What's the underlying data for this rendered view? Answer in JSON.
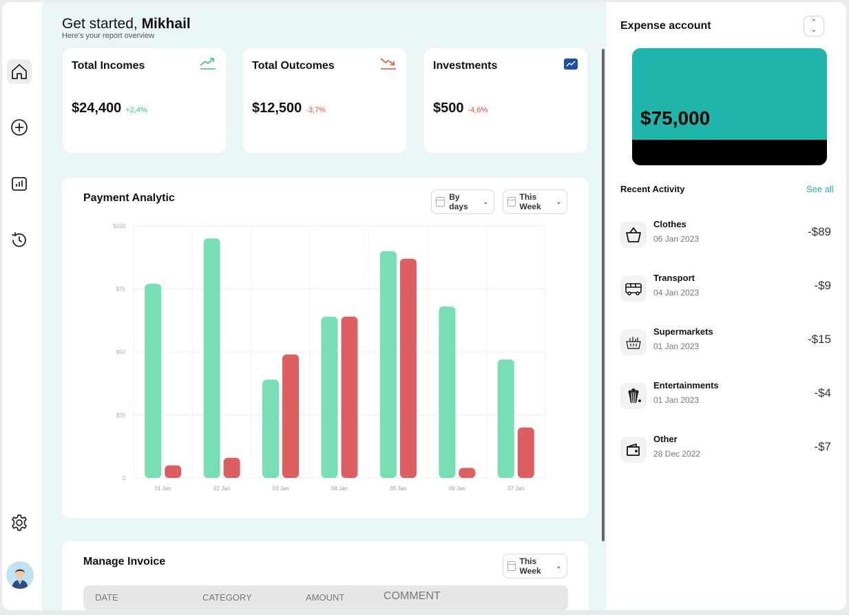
{
  "greeting": {
    "prefix": "Get started,",
    "name": "Mikhail",
    "subtitle": "Here's your report overview"
  },
  "sidebar": {
    "items": [
      {
        "name": "home",
        "icon": "home-icon"
      },
      {
        "name": "add",
        "icon": "plus-circle-icon"
      },
      {
        "name": "reports",
        "icon": "bar-chart-icon"
      },
      {
        "name": "history",
        "icon": "history-icon"
      },
      {
        "name": "settings",
        "icon": "gear-icon"
      }
    ]
  },
  "cards": [
    {
      "label": "Total Incomes",
      "amount": "$24,400",
      "change": "+2,4%",
      "color": "#2ecc71",
      "icon": "trending-up-icon"
    },
    {
      "label": "Total Outcomes",
      "amount": "$12,500",
      "change": "-3,7%",
      "color": "#e74c3c",
      "icon": "trending-down-icon"
    },
    {
      "label": "Investments",
      "amount": "$500",
      "change": "-4,6%",
      "color": "#e74c3c",
      "icon": "chart-badge-icon"
    }
  ],
  "payment": {
    "title": "Payment Analytic",
    "period_dropdown": "By days",
    "range_dropdown": "This Week"
  },
  "chart_data": {
    "type": "bar",
    "categories": [
      "01 Jan",
      "02 Jan",
      "03 Jan",
      "04 Jan",
      "05 Jan",
      "06 Jan",
      "07 Jan"
    ],
    "series": [
      {
        "values": [
          77,
          95,
          39,
          64,
          90,
          68,
          47
        ],
        "color": "#77dfb3"
      },
      {
        "values": [
          5,
          8,
          49,
          64,
          87,
          4,
          20
        ],
        "color": "#dd5f60"
      }
    ],
    "y_ticks": [
      "$100",
      "$75",
      "$50",
      "$25",
      "0"
    ],
    "ylim": [
      0,
      100
    ],
    "grid": true
  },
  "invoice": {
    "title": "Manage Invoice",
    "range_dropdown": "This Week",
    "columns": [
      "DATE",
      "CATEGORY",
      "AMOUNT",
      "COMMENT"
    ]
  },
  "account": {
    "title": "Expense account",
    "balance": "$75,000",
    "card_color": "#20b5aa"
  },
  "activity": {
    "title": "Recent Activity",
    "see_all": "See all",
    "items": [
      {
        "name": "Clothes",
        "date": "06 Jan 2023",
        "amount": "-$89",
        "icon": "basket-icon"
      },
      {
        "name": "Transport",
        "date": "04 Jan 2023",
        "amount": "-$9",
        "icon": "bus-icon"
      },
      {
        "name": "Supermarkets",
        "date": "01 Jan 2023",
        "amount": "-$15",
        "icon": "grocery-basket-icon"
      },
      {
        "name": "Entertainments",
        "date": "01 Jan 2023",
        "amount": "-$4",
        "icon": "popcorn-icon"
      },
      {
        "name": "Other",
        "date": "28 Dec 2022",
        "amount": "-$7",
        "icon": "wallet-icon"
      }
    ]
  }
}
